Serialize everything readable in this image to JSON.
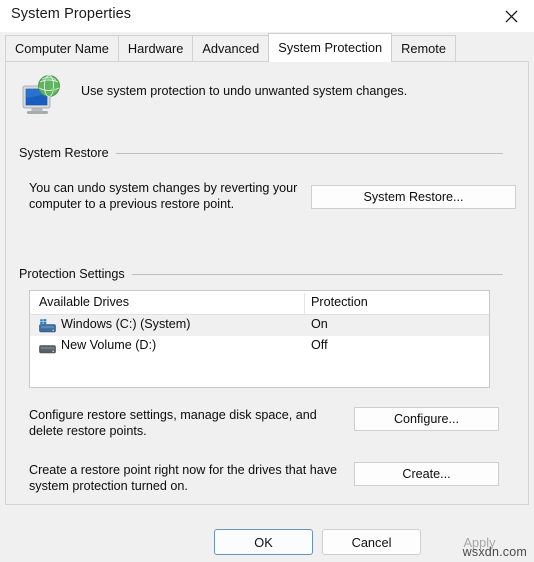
{
  "window": {
    "title": "System Properties",
    "close_label": "Close"
  },
  "tabs": [
    {
      "label": "Computer Name",
      "active": false
    },
    {
      "label": "Hardware",
      "active": false
    },
    {
      "label": "Advanced",
      "active": false
    },
    {
      "label": "System Protection",
      "active": true
    },
    {
      "label": "Remote",
      "active": false
    }
  ],
  "header": {
    "icon": "system-protection-computer-globe-icon",
    "description": "Use system protection to undo unwanted system changes."
  },
  "system_restore": {
    "group_label": "System Restore",
    "description": "You can undo system changes by reverting your computer to a previous restore point.",
    "button_label": "System Restore..."
  },
  "protection_settings": {
    "group_label": "Protection Settings",
    "columns": [
      "Available Drives",
      "Protection"
    ],
    "rows": [
      {
        "drive": "Windows (C:) (System)",
        "protection": "On",
        "selected": true,
        "icon": "windows-system-drive-icon"
      },
      {
        "drive": "New Volume (D:)",
        "protection": "Off",
        "selected": false,
        "icon": "hard-drive-icon"
      }
    ],
    "configure": {
      "description": "Configure restore settings, manage disk space, and delete restore points.",
      "button_label": "Configure..."
    },
    "create": {
      "description": "Create a restore point right now for the drives that have system protection turned on.",
      "button_label": "Create..."
    }
  },
  "footer": {
    "ok_label": "OK",
    "cancel_label": "Cancel",
    "apply_label": "Apply"
  },
  "watermark": "wsxdn.com",
  "colors": {
    "dialog_background": "#f0f0f0",
    "titlebar_background": "#ffffff",
    "active_tab_background": "#ffffff",
    "default_button_border": "#6e93b8",
    "selected_row_background": "#f0f0f0",
    "group_rule": "#bfbfbf",
    "disabled_text": "#a6a6a6"
  }
}
